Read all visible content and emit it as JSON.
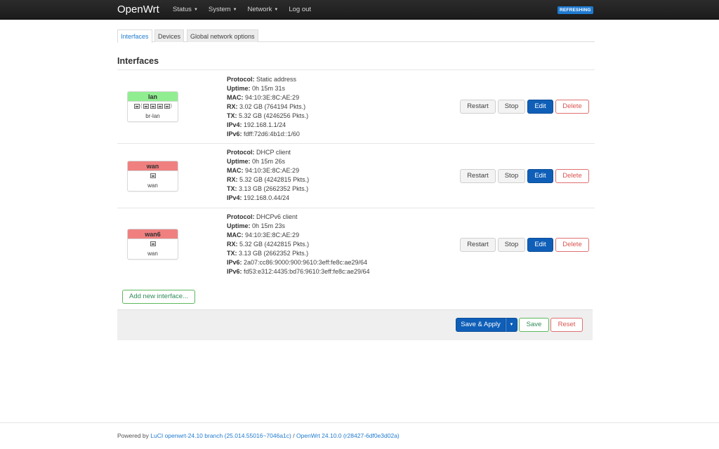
{
  "navbar": {
    "brand": "OpenWrt",
    "menu": [
      {
        "label": "Status",
        "has_caret": true
      },
      {
        "label": "System",
        "has_caret": true
      },
      {
        "label": "Network",
        "has_caret": true
      },
      {
        "label": "Log out",
        "has_caret": false
      }
    ],
    "status_badge": "REFRESHING",
    "badge_color": "#1f7ad0"
  },
  "tabs": [
    {
      "label": "Interfaces",
      "active": true
    },
    {
      "label": "Devices",
      "active": false
    },
    {
      "label": "Global network options",
      "active": false
    }
  ],
  "section_title": "Interfaces",
  "interfaces": [
    {
      "name": "lan",
      "head_color": "#90ee90",
      "device": "br-lan",
      "icon": "bridge-ports-icon",
      "details": [
        {
          "key": "Protocol:",
          "value": "Static address"
        },
        {
          "key": "Uptime:",
          "value": "0h 15m 31s"
        },
        {
          "key": "MAC:",
          "value": "94:10:3E:8C:AE:29"
        },
        {
          "key": "RX:",
          "value": "3.02 GB (764194 Pkts.)"
        },
        {
          "key": "TX:",
          "value": "5.32 GB (4246256 Pkts.)"
        },
        {
          "key": "IPv4:",
          "value": "192.168.1.1/24"
        },
        {
          "key": "IPv6:",
          "value": "fdff:72d6:4b1d::1/60"
        }
      ]
    },
    {
      "name": "wan",
      "head_color": "#f08080",
      "device": "wan",
      "icon": "ethernet-port-icon",
      "details": [
        {
          "key": "Protocol:",
          "value": "DHCP client"
        },
        {
          "key": "Uptime:",
          "value": "0h 15m 26s"
        },
        {
          "key": "MAC:",
          "value": "94:10:3E:8C:AE:29"
        },
        {
          "key": "RX:",
          "value": "5.32 GB (4242815 Pkts.)"
        },
        {
          "key": "TX:",
          "value": "3.13 GB (2662352 Pkts.)"
        },
        {
          "key": "IPv4:",
          "value": "192.168.0.44/24"
        }
      ]
    },
    {
      "name": "wan6",
      "head_color": "#f08080",
      "device": "wan",
      "icon": "ethernet-port-icon",
      "details": [
        {
          "key": "Protocol:",
          "value": "DHCPv6 client"
        },
        {
          "key": "Uptime:",
          "value": "0h 15m 23s"
        },
        {
          "key": "MAC:",
          "value": "94:10:3E:8C:AE:29"
        },
        {
          "key": "RX:",
          "value": "5.32 GB (4242815 Pkts.)"
        },
        {
          "key": "TX:",
          "value": "3.13 GB (2662352 Pkts.)"
        },
        {
          "key": "IPv6:",
          "value": "2a07:cc86:9000:900:9610:3eff:fe8c:ae29/64"
        },
        {
          "key": "IPv6:",
          "value": "fd53:e312:4435:bd76:9610:3eff:fe8c:ae29/64"
        }
      ]
    }
  ],
  "row_buttons": {
    "restart": "Restart",
    "stop": "Stop",
    "edit": "Edit",
    "delete": "Delete"
  },
  "add_interface_label": "Add new interface...",
  "actions": {
    "save_apply": "Save & Apply",
    "dropdown_icon": "caret-down-icon",
    "save": "Save",
    "reset": "Reset"
  },
  "footer": {
    "prefix": "Powered by ",
    "luci_link": "LuCI openwrt-24.10 branch (25.014.55016~7046a1c)",
    "separator": " / ",
    "openwrt_link": "OpenWrt 24.10.0 (r28427-6df0e3d02a)"
  }
}
